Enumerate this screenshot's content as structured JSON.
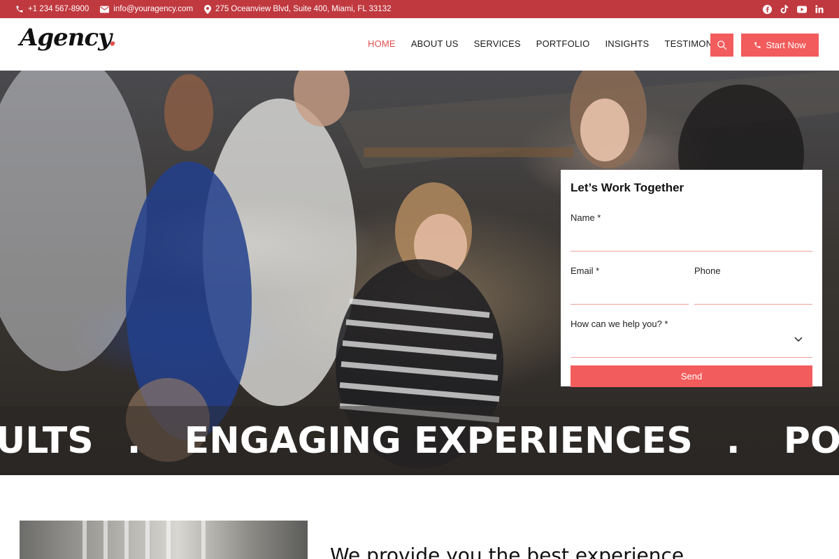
{
  "topbar": {
    "phone": "+1 234 567-8900",
    "email": "info@youragency.com",
    "address": "275 Oceanview Blvd, Suite 400, Miami, FL 33132",
    "socials": [
      "facebook-icon",
      "tiktok-icon",
      "youtube-icon",
      "linkedin-icon"
    ],
    "color": "#c0393f"
  },
  "header": {
    "logo": "Agency",
    "nav": [
      "HOME",
      "ABOUT US",
      "SERVICES",
      "PORTFOLIO",
      "INSIGHTS",
      "TESTIMONIALS"
    ],
    "active_nav": "HOME",
    "cta_label": "Start Now",
    "accent": "#f25c5c"
  },
  "hero": {
    "marquee": [
      "ULTS",
      ".",
      "ENGAGING EXPERIENCES",
      ".",
      "POWERF"
    ]
  },
  "form": {
    "title": "Let’s Work Together",
    "name_label": "Name *",
    "email_label": "Email *",
    "phone_label": "Phone",
    "help_label": "How can we help you? *",
    "send_label": "Send"
  },
  "about": {
    "title": "We provide you the best experience"
  }
}
